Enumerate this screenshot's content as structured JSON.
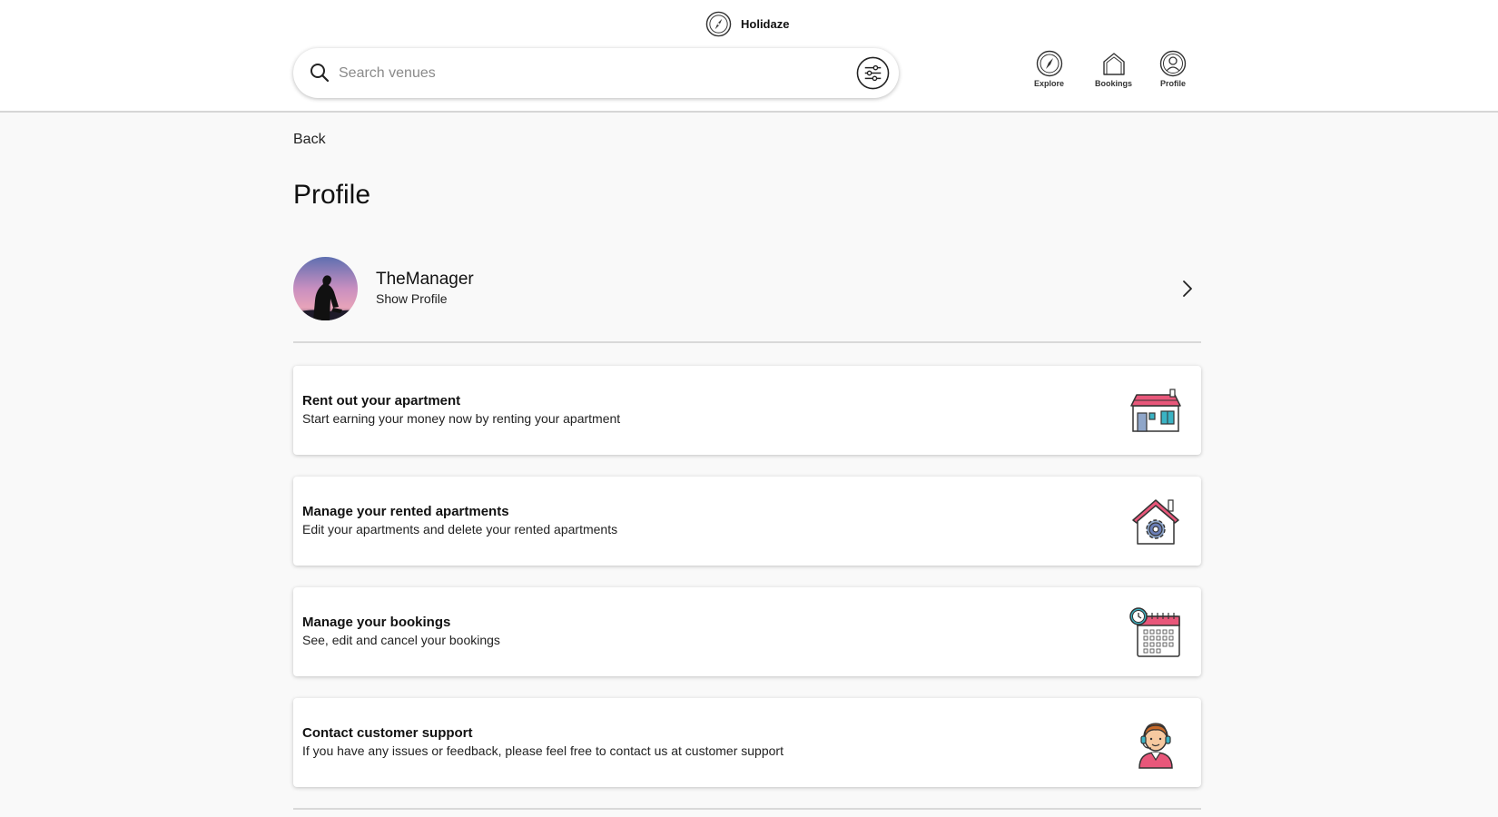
{
  "app": {
    "name": "Holidaze"
  },
  "search": {
    "placeholder": "Search venues"
  },
  "nav": [
    {
      "label": "Explore",
      "icon": "compass-icon"
    },
    {
      "label": "Bookings",
      "icon": "house-icon"
    },
    {
      "label": "Profile",
      "icon": "user-icon"
    }
  ],
  "back_label": "Back",
  "page_title": "Profile",
  "user": {
    "name": "TheManager",
    "action": "Show Profile"
  },
  "cards": [
    {
      "title": "Rent out your apartment",
      "desc": "Start earning your money now by renting your apartment",
      "icon": "house-rent-icon"
    },
    {
      "title": "Manage your rented apartments",
      "desc": "Edit your apartments and delete your rented apartments",
      "icon": "house-gear-icon"
    },
    {
      "title": "Manage your bookings",
      "desc": "See, edit and cancel your bookings",
      "icon": "calendar-clock-icon"
    },
    {
      "title": "Contact customer support",
      "desc": "If you have any issues or feedback, please feel free to contact us at customer support",
      "icon": "support-agent-icon"
    }
  ],
  "colors": {
    "accent_pink": "#e8577a",
    "accent_teal": "#3bb3c4",
    "divider": "#d9d9d9"
  }
}
